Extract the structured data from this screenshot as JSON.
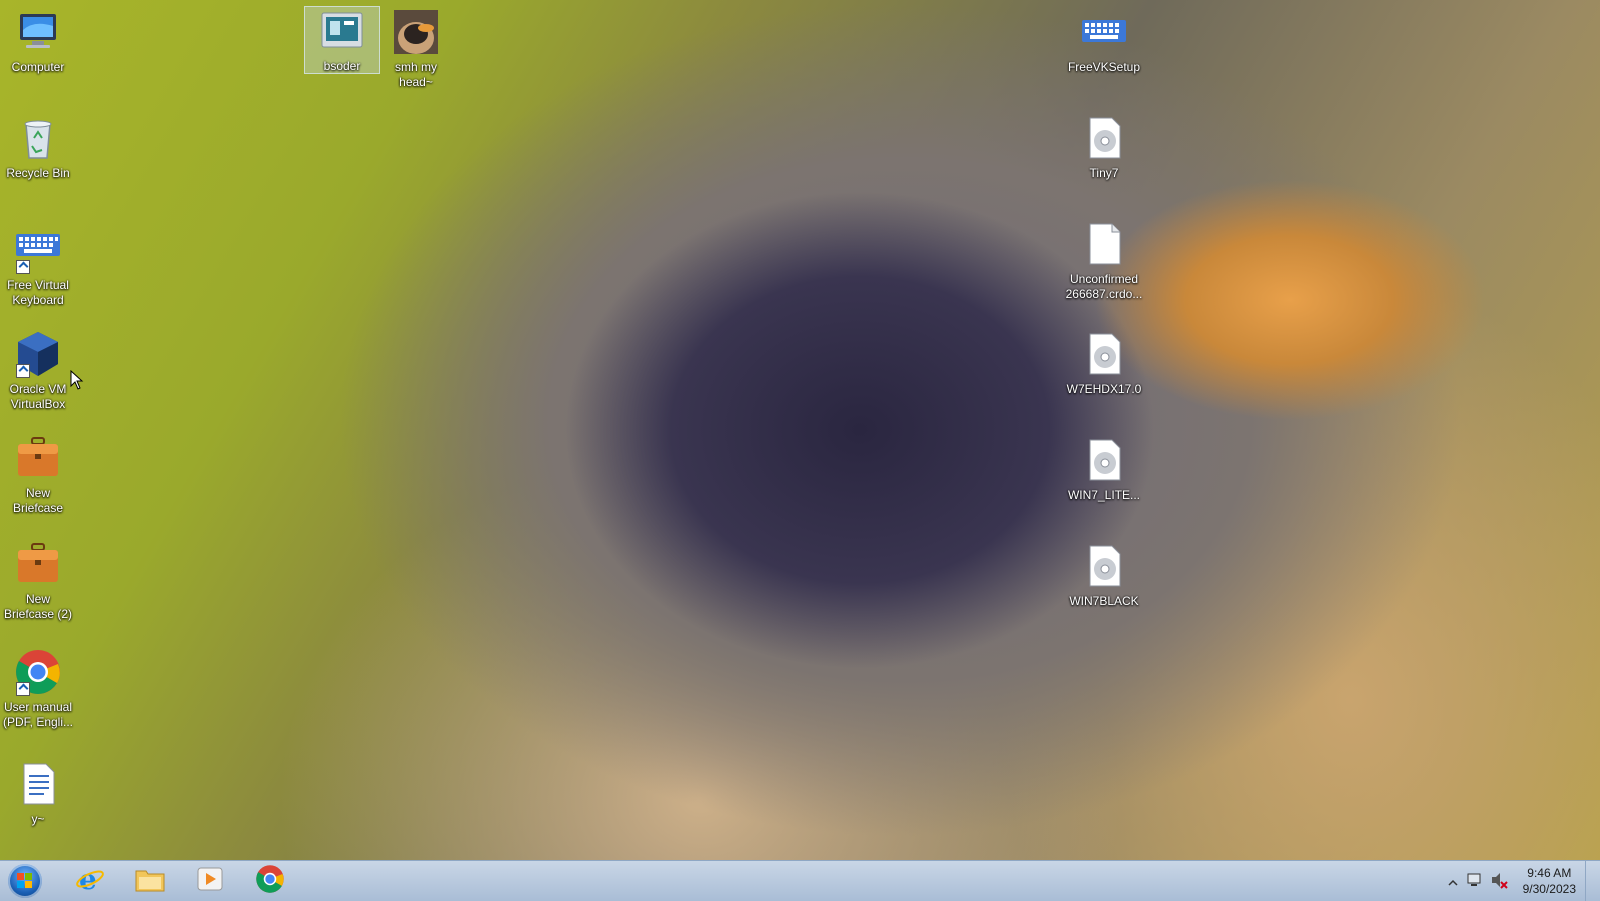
{
  "desktop": {
    "left_column": [
      {
        "label": "Computer",
        "icon": "computer-icon"
      },
      {
        "label": "Recycle Bin",
        "icon": "recycle-bin-icon"
      },
      {
        "label": "Free Virtual Keyboard",
        "icon": "keyboard-icon"
      },
      {
        "label": "Oracle VM VirtualBox",
        "icon": "virtualbox-icon"
      },
      {
        "label": "New Briefcase",
        "icon": "briefcase-icon"
      },
      {
        "label": "New Briefcase (2)",
        "icon": "briefcase-icon"
      },
      {
        "label": "User manual (PDF, Engli...",
        "icon": "chrome-icon"
      },
      {
        "label": "y~",
        "icon": "text-file-icon"
      }
    ],
    "top_row": [
      {
        "label": "bsoder",
        "icon": "bsoder-icon",
        "selected": true
      },
      {
        "label": "smh my head~",
        "icon": "image-file-icon"
      }
    ],
    "right_column": [
      {
        "label": "FreeVKSetup",
        "icon": "keyboard-icon"
      },
      {
        "label": "Tiny7",
        "icon": "disc-image-icon"
      },
      {
        "label": "Unconfirmed 266687.crdo...",
        "icon": "blank-file-icon"
      },
      {
        "label": "W7EHDX17.0",
        "icon": "disc-image-icon"
      },
      {
        "label": "WIN7_LITE...",
        "icon": "disc-image-icon"
      },
      {
        "label": "WIN7BLACK",
        "icon": "disc-image-icon"
      }
    ]
  },
  "taskbar": {
    "pinned": [
      {
        "name": "internet-explorer-icon"
      },
      {
        "name": "file-explorer-icon"
      },
      {
        "name": "media-player-icon"
      },
      {
        "name": "chrome-icon"
      }
    ],
    "clock": {
      "time": "9:46 AM",
      "date": "9/30/2023"
    }
  },
  "colors": {
    "taskbar": "#b7c8dd",
    "accent": "#1a5fb4"
  }
}
